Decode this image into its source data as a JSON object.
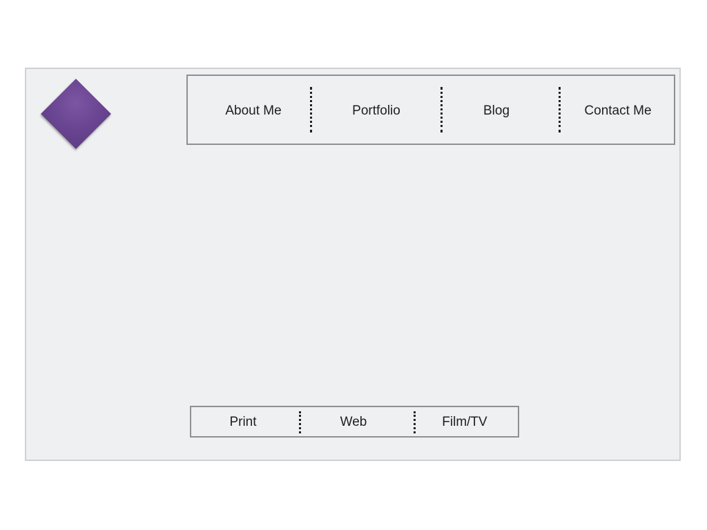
{
  "logo": {
    "shape": "diamond",
    "color": "#6a4591"
  },
  "nav": {
    "items": [
      {
        "label": "About Me"
      },
      {
        "label": "Portfolio"
      },
      {
        "label": "Blog"
      },
      {
        "label": "Contact Me"
      }
    ]
  },
  "subnav": {
    "items": [
      {
        "label": "Print"
      },
      {
        "label": "Web"
      },
      {
        "label": "Film/TV"
      }
    ]
  }
}
